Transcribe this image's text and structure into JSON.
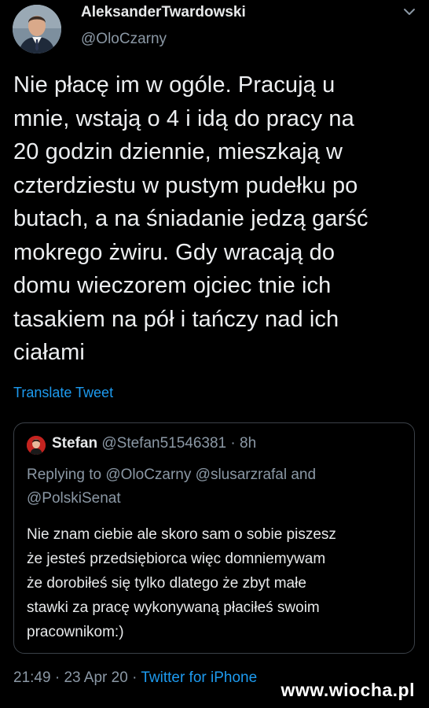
{
  "author": {
    "display_name": "AleksanderTwardowski",
    "handle": "@OloCzarny"
  },
  "tweet": {
    "lines": [
      "Nie płacę im w ogóle. Pracują u",
      "mnie, wstają o 4 i idą do pracy na",
      "20 godzin dziennie, mieszkają w",
      "czterdziestu w pustym pudełku po",
      "butach, a na śniadanie jedzą garść",
      "mokrego żwiru. Gdy wracają do",
      "domu wieczorem ojciec tnie ich",
      "tasakiem na pół i tańczy nad ich",
      "ciałami"
    ],
    "translate_label": "Translate Tweet",
    "time": "21:49",
    "date": "23 Apr 20",
    "source": "Twitter for iPhone",
    "separator": "·"
  },
  "quoted": {
    "name": "Stefan",
    "handle": "@Stefan51546381",
    "age": "8h",
    "separator": "·",
    "replying_lines": [
      "Replying to @OloCzarny @slusarzrafal and",
      "@PolskiSenat"
    ],
    "text_lines": [
      "Nie znam ciebie ale skoro sam o sobie piszesz",
      "że jesteś przedsiębiorca więc domniemywam",
      "że dorobiłeś się tylko dlatego że zbyt małe",
      "stawki za pracę wykonywaną płaciłeś swoim",
      "pracownikom:)"
    ]
  },
  "icons": {
    "avatar": "user-avatar-photo",
    "menu": "chevron-down-icon"
  },
  "colors": {
    "background": "#000000",
    "accent": "#1d9bf0",
    "secondary_text": "#8b98a5",
    "border": "#3b4148"
  },
  "watermark": "www.wiocha.pl"
}
